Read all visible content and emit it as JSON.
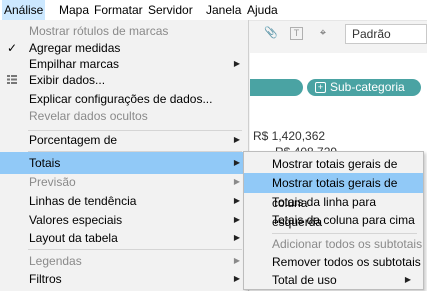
{
  "menubar": {
    "items": [
      {
        "label": "Análise",
        "active": true
      },
      {
        "label": "Mapa"
      },
      {
        "label": "Formatar"
      },
      {
        "label": "Servidor"
      },
      {
        "label": "Janela"
      },
      {
        "label": "Ajuda"
      }
    ]
  },
  "toolbar": {
    "dropdown_value": "Padrão"
  },
  "shelf": {
    "pill_label": "Sub-categoria"
  },
  "canvas": {
    "values": [
      "R$ 1,420,362",
      "R$ 408,729"
    ]
  },
  "menu": {
    "items": [
      {
        "label": "Mostrar rótulos de marcas",
        "disabled": true
      },
      {
        "label": "Agregar medidas",
        "checked": true
      },
      {
        "label": "Empilhar marcas",
        "submenu": true
      },
      {
        "label": "Exibir dados...",
        "icon": "grid-icon"
      },
      {
        "label": "Explicar configurações de dados..."
      },
      {
        "label": "Revelar dados ocultos",
        "disabled": true
      },
      {
        "label": "Porcentagem de",
        "submenu": true
      },
      {
        "label": "Totais",
        "submenu": true,
        "highlighted": true
      },
      {
        "label": "Previsão",
        "disabled": true,
        "submenu": true
      },
      {
        "label": "Linhas de tendência",
        "submenu": true
      },
      {
        "label": "Valores especiais",
        "submenu": true
      },
      {
        "label": "Layout da tabela",
        "submenu": true
      },
      {
        "label": "Legendas",
        "disabled": true,
        "submenu": true
      },
      {
        "label": "Filtros",
        "submenu": true
      }
    ]
  },
  "submenu": {
    "items": [
      {
        "label": "Mostrar totais gerais de linha"
      },
      {
        "label": "Mostrar totais gerais de coluna",
        "highlighted": true
      },
      {
        "label": "Totais da linha para esquerda"
      },
      {
        "label": "Totais da coluna para cima"
      },
      {
        "label": "Adicionar todos os subtotais",
        "disabled": true
      },
      {
        "label": "Remover todos os subtotais"
      },
      {
        "label": "Total de uso",
        "submenu": true
      }
    ]
  }
}
